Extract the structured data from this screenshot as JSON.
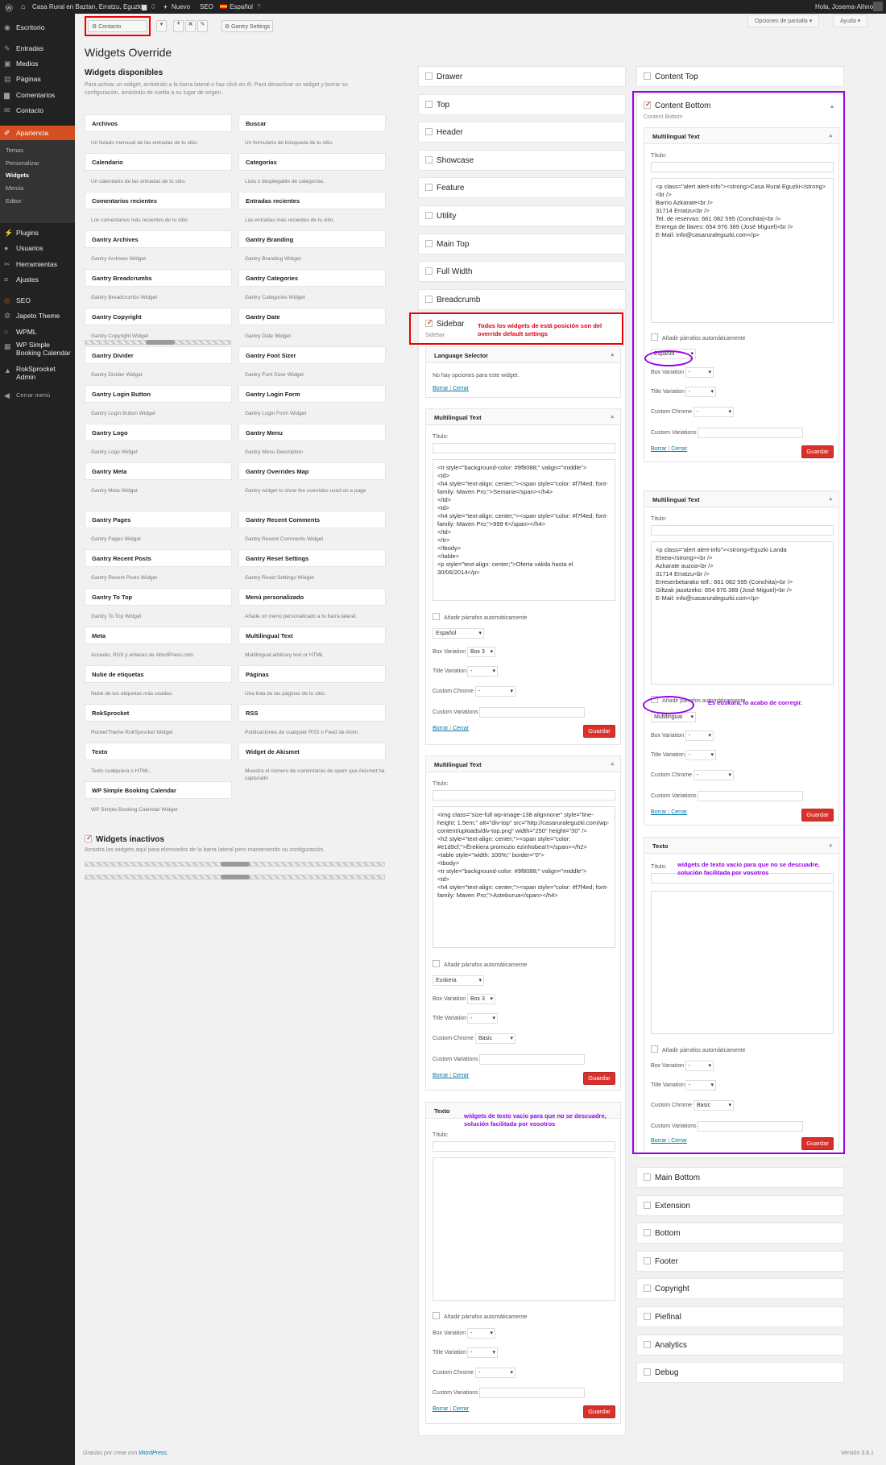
{
  "adminbar": {
    "site": "Casa Rural en Baztan, Erratzu, Eguzki",
    "comments": "0",
    "new": "Nuevo",
    "seo": "SEO",
    "lang": "Español",
    "howdy": "Hola, Josema-Aihnoa"
  },
  "menu": {
    "items": [
      "Escritorio",
      "Entradas",
      "Medios",
      "Páginas",
      "Comentarios",
      "Contacto",
      "Apariencia"
    ],
    "appearance_sub": [
      "Temas",
      "Personalizar",
      "Widgets",
      "Menús",
      "Editor"
    ],
    "items2": [
      "Plugins",
      "Usuarios",
      "Herramientas",
      "Ajustes",
      "SEO",
      "Japeto Theme",
      "WPML",
      "WP Simple Booking Calendar",
      "RokSprocket Admin",
      "Cerrar menú"
    ]
  },
  "toolbar": {
    "override_select": "Contacto",
    "gantry_settings": "Gantry Settings",
    "screen_options": "Opciones de pantalla",
    "help": "Ayuda"
  },
  "page_title": "Widgets Override",
  "available": {
    "title": "Widgets disponibles",
    "desc": "Para activar un widget, arrástralo a la barra lateral o haz click en él. Para desactivar un widget y borrar su configuración, arrástralo de vuelta a su lugar de origen.",
    "widgets": [
      {
        "name": "Archivos",
        "desc": "Un listado mensual de las entradas de tu sitio."
      },
      {
        "name": "Buscar",
        "desc": "Un formulario de búsqueda de tu sitio."
      },
      {
        "name": "Calendario",
        "desc": "Un calendario de las entradas de tu sitio."
      },
      {
        "name": "Categorías",
        "desc": "Lista o desplegable de categorías."
      },
      {
        "name": "Comentarios recientes",
        "desc": "Los comentarios más recientes de tu sitio."
      },
      {
        "name": "Entradas recientes",
        "desc": "Las entradas más recientes de tu sitio."
      },
      {
        "name": "Gantry Archives",
        "desc": "Gantry Archives Widget"
      },
      {
        "name": "Gantry Branding",
        "desc": "Gantry Branding Widget"
      },
      {
        "name": "Gantry Breadcrumbs",
        "desc": "Gantry Breadcrumbs Widget"
      },
      {
        "name": "Gantry Categories",
        "desc": "Gantry Categories Widget"
      },
      {
        "name": "Gantry Copyright",
        "desc": "Gantry Copyright Widget"
      },
      {
        "name": "Gantry Date",
        "desc": "Gantry Date Widget"
      },
      {
        "name": "Gantry Divider",
        "desc": "Gantry Divider Widget"
      },
      {
        "name": "Gantry Font Sizer",
        "desc": "Gantry Font Sizer Widget"
      },
      {
        "name": "Gantry Login Button",
        "desc": "Gantry Login Button Widget"
      },
      {
        "name": "Gantry Login Form",
        "desc": "Gantry Login Form Widget"
      },
      {
        "name": "Gantry Logo",
        "desc": "Gantry Logo Widget"
      },
      {
        "name": "Gantry Menu",
        "desc": "Gantry Menu Description"
      },
      {
        "name": "Gantry Meta",
        "desc": "Gantry Meta Widget"
      },
      {
        "name": "Gantry Overrides Map",
        "desc": "Gantry widget to show the overrides used on a page"
      },
      {
        "name": "Gantry Pages",
        "desc": "Gantry Pages Widget"
      },
      {
        "name": "Gantry Recent Comments",
        "desc": "Gantry Recent Comments Widget"
      },
      {
        "name": "Gantry Recent Posts",
        "desc": "Gantry Recent Posts Widget"
      },
      {
        "name": "Gantry Reset Settings",
        "desc": "Gantry Reset Settings Widget"
      },
      {
        "name": "Gantry To Top",
        "desc": "Gantry To Top Widget"
      },
      {
        "name": "Menú personalizado",
        "desc": "Añade un menú personalizado a tu barra lateral."
      },
      {
        "name": "Meta",
        "desc": "Acceder, RSS y enlaces de WordPress.com."
      },
      {
        "name": "Multilingual Text",
        "desc": "Multilingual arbitrary text or HTML"
      },
      {
        "name": "Nube de etiquetas",
        "desc": "Nube de tus etiquetas más usadas."
      },
      {
        "name": "Páginas",
        "desc": "Una lista de las páginas de tu sitio."
      },
      {
        "name": "RokSprocket",
        "desc": "RocketTheme RokSprocket Widget"
      },
      {
        "name": "RSS",
        "desc": "Publicaciones de cualquier RSS o Feed de Atom."
      },
      {
        "name": "Texto",
        "desc": "Texto cualquiera o HTML."
      },
      {
        "name": "Widget de Akismet",
        "desc": "Muestra el número de comentarios de spam que Akismet ha capturado"
      },
      {
        "name": "WP Simple Booking Calendar",
        "desc": "WP Simple Booking Calendar Widget"
      }
    ]
  },
  "inactive": {
    "title": "Widgets inactivos",
    "desc": "Arrastra los widgets aquí para eliminarlos de la barra lateral pero manteniendo su configuración."
  },
  "middle_sidebars": [
    "Drawer",
    "Top",
    "Header",
    "Showcase",
    "Feature",
    "Utility",
    "Main Top",
    "Full Width",
    "Breadcrumb"
  ],
  "right_sidebars_top": [
    "Content Top"
  ],
  "right_sidebars_bottom": [
    "Main Bottom",
    "Extension",
    "Bottom",
    "Footer",
    "Copyright",
    "Piefinal",
    "Analytics",
    "Debug"
  ],
  "sidebar_panel": {
    "title": "Sidebar",
    "sub": "Sidebar",
    "lang_selector": {
      "title": "Language Selector",
      "text": "No hay opciones para este widget."
    },
    "mt1": {
      "title": "Multilingual Text",
      "content": "<tr style=\"background-color: #9f8088;\" valign=\"middle\">\n<td>\n<h4 style=\"text-align: center;\"><span style=\"color: #f7f4ed; font-family: Maven Pro;\">Semana</span></h4>\n</td>\n<td>\n<h4 style=\"text-align: center;\"><span style=\"color: #f7f4ed; font-family: Maven Pro;\">999 €</span></h4>\n</td>\n</tr>\n</tbody>\n</table>\n<p style=\"text-align: center;\">Oferta válida hasta el 30/06/2014</p>",
      "lang": "Español",
      "box": "Box 3",
      "title_var": "-",
      "chrome": "-"
    },
    "mt2": {
      "title": "Multilingual Text",
      "content": "<img class=\"size-full wp-image-138 alignnone\" style=\"line-height: 1.5em;\" alt=\"div-top\" src=\"http://casaruraleguzki.com/wp-content/uploads/div-top.png\" width=\"250\" height=\"30\" />\n<h2 style=\"text-align: center;\"><span style=\"color: #e1d9cf;\">Ērekiera promozio ezinhobea!!!</span></h2>\n<table style=\"width: 100%;\" border=\"0\">\n<tbody>\n<tr style=\"background-color: #9f8088;\" valign=\"middle\">\n<td>\n<h4 style=\"text-align: center;\"><span style=\"color: #f7f4ed; font-family: Maven Pro;\">Asteburua</span></h4>",
      "lang": "Euskera",
      "box": "Box 3",
      "title_var": "-",
      "chrome": "Basic"
    },
    "texto": {
      "title": "Texto",
      "box": "-",
      "title_var": "-",
      "chrome": "-"
    }
  },
  "content_bottom": {
    "title": "Content Bottom",
    "sub": "Content Bottom",
    "mt1": {
      "title": "Multilingual Text",
      "content": "<p class=\"alert alert-info\"><strong>Casa Rural Eguzki</strong><br />\nBarrio Azkarate<br />\n31714 Erratzu<br />\nTel. de reservas: 661 082 595 (Conchita)<br />\nEntrega de llaves: 654 976 389 (José Miguel)<br />\nE-Mail: info@casaruraleguzki.com</p>",
      "lang": "Español",
      "box": "-",
      "title_var": "-",
      "chrome": "-"
    },
    "mt2": {
      "title": "Multilingual Text",
      "content": "<p class=\"alert alert-info\"><strong>Eguzki Landa Etxea</strong><br />\nAzkarate auzoa<br />\n31714 Erratzu<br />\nErreserbetarako telf.: 661 082 595 (Conchita)<br />\nGiltzak jasotzeko: 654 976 389 (José Miguel)<br />\nE-Mail: info@casaruraleguzki.com</p>",
      "lang": "Multilingual",
      "box": "-",
      "title_var": "-",
      "chrome": "-"
    },
    "texto": {
      "title": "Texto",
      "box": "-",
      "title_var": "-",
      "chrome": "Basic"
    }
  },
  "labels": {
    "titulo": "Título:",
    "autop": "Añadir párrafos automáticamente",
    "box": "Box Variation",
    "titlevar": "Title Variation",
    "chrome": "Custom Chrome",
    "customvar": "Custom Variations",
    "borrar": "Borrar",
    "cerrar": "Cerrar",
    "guardar": "Guardar",
    "sep": "|"
  },
  "notes": {
    "red": "Todos los widgets de está posición son del override default settings",
    "purple_lang": "Es euskara, lo acabo de corregir.",
    "purple_text": "widgets de texto vacio para que no se descuadre, solución facilitada por vosotros"
  },
  "footer": {
    "thanks_pre": "Gracias por crear con ",
    "wp": "WordPress",
    "version": "Versión 3.8.1"
  },
  "colors": {
    "accent": "#d54e21",
    "adminbar": "#222222",
    "annotation_red": "#e0001a",
    "annotation_purple": "#9900ee",
    "save": "#d9302c"
  }
}
